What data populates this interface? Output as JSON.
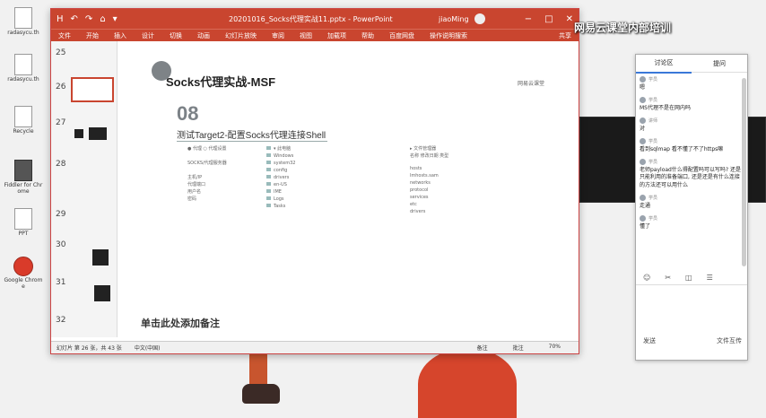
{
  "desktop": {
    "icons": [
      {
        "label": "radasycu.th"
      },
      {
        "label": "radasycu.th"
      },
      {
        "label": "Recycle"
      },
      {
        "label": "Fiddler for Chrome"
      },
      {
        "label": "PPT"
      },
      {
        "label": "Google Chrome"
      }
    ]
  },
  "overlay_text": "网易云课堂内部培训",
  "powerpoint": {
    "title": "20201016_Socks代理实战11.pptx",
    "app": "PowerPoint",
    "user": "jiaoMing",
    "quick_access": [
      "H",
      "↶",
      "↷",
      "⌂",
      "▾"
    ],
    "window_controls": [
      "−",
      "□",
      "✕"
    ],
    "ribbon_tabs": [
      "文件",
      "开始",
      "插入",
      "设计",
      "切换",
      "动画",
      "幻灯片放映",
      "审阅",
      "视图",
      "加载项",
      "帮助",
      "百度网盘",
      "操作说明搜索"
    ],
    "share": "共享",
    "thumbnails": [
      {
        "num": "25"
      },
      {
        "num": "26"
      },
      {
        "num": "27"
      },
      {
        "num": "28"
      },
      {
        "num": "29"
      },
      {
        "num": "30"
      },
      {
        "num": "31"
      },
      {
        "num": "32"
      }
    ],
    "slide": {
      "heading": "Socks代理实战-MSF",
      "brand": "网易云课堂",
      "section_number": "08",
      "subtitle": "测试Target2-配置Socks代理连接Shell",
      "left_lines": [
        "● 代理  ○ 代理设置",
        "SOCKS/代理服务器",
        "主机/IP",
        "代理端口",
        "用户名",
        "密码"
      ],
      "middle_lines": [
        "▾ 此电脑",
        "Windows",
        "system32",
        "config",
        "drivers",
        "en-US",
        "IME",
        "Logs",
        "Tasks"
      ],
      "right_lines": [
        "▸ 文件管理器",
        "名称   修改日期   类型",
        "hosts",
        "lmhosts.sam",
        "networks",
        "protocol",
        "services",
        "etc",
        "drivers"
      ]
    },
    "notes_placeholder": "单击此处添加备注",
    "status": {
      "slide_of": "幻灯片 第 26 张，共 43 张",
      "lang": "中文(中国)",
      "notes_btn": "备注",
      "comments_btn": "批注",
      "zoom": "70%"
    }
  },
  "chat": {
    "tabs": [
      "讨论区",
      "提问"
    ],
    "messages": [
      {
        "user": "学员",
        "text": "嗯"
      },
      {
        "user": "学员",
        "text": "MS代理不是在网内吗"
      },
      {
        "user": "讲师",
        "text": "对"
      },
      {
        "user": "学员",
        "text": "看到sqlmap 看不懂了不了https嘛"
      },
      {
        "user": "学员",
        "text": "老师payload什么得配置吗可以写吗? 还是只能利用的准备端口, 还是还是有什么连接的方法还可以用什么"
      },
      {
        "user": "学员",
        "text": "走通"
      },
      {
        "user": "学员",
        "text": "懂了"
      }
    ],
    "tools": [
      "☺",
      "✂",
      "◫",
      "☰"
    ],
    "footer_left": "发送",
    "footer_right": "文件互传"
  }
}
